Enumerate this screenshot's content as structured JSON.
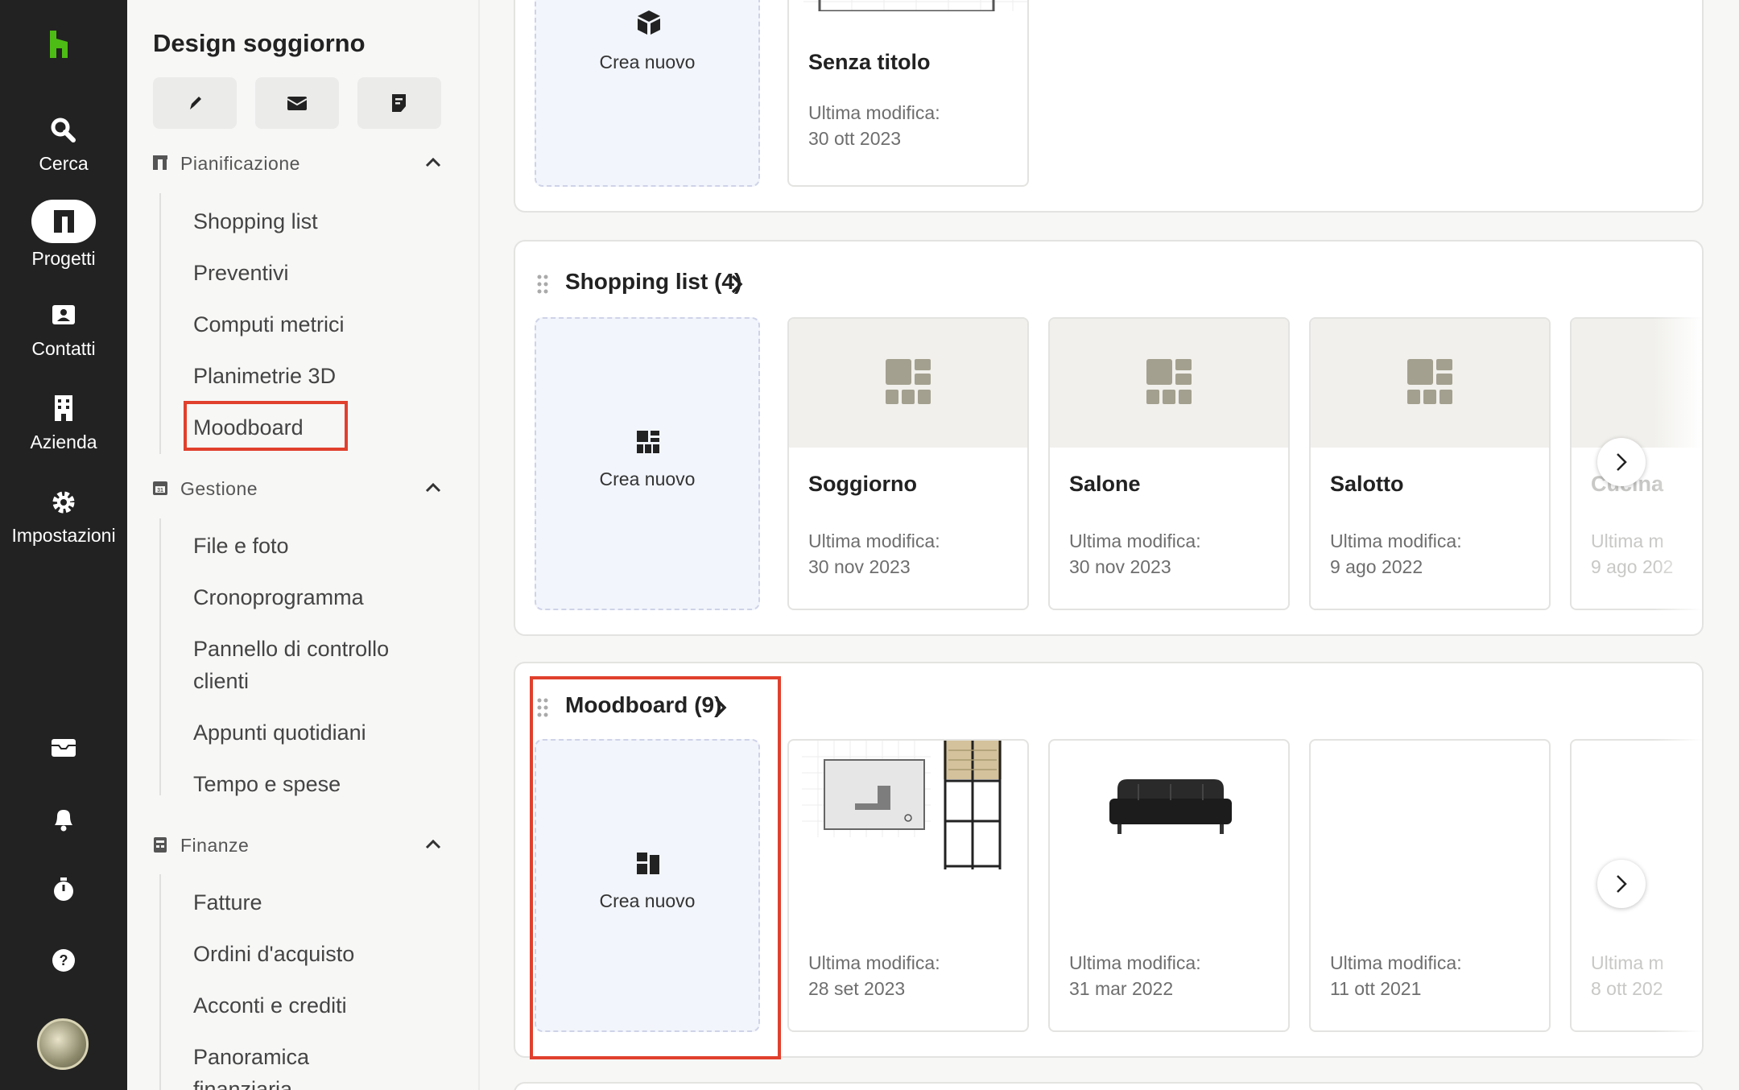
{
  "rail": {
    "logo_icon": "houzz-logo-icon",
    "brand_color": "#4dbc15",
    "items": [
      {
        "label": "Cerca",
        "icon": "search-icon"
      },
      {
        "label": "Progetti",
        "icon": "projects-icon"
      },
      {
        "label": "Contatti",
        "icon": "contacts-icon"
      },
      {
        "label": "Azienda",
        "icon": "building-icon"
      },
      {
        "label": "Impostazioni",
        "icon": "gear-icon"
      }
    ],
    "bottom_icons": [
      "inbox-icon",
      "bell-icon",
      "timer-icon",
      "help-icon",
      "avatar"
    ]
  },
  "sidebar": {
    "title": "Design soggiorno",
    "actions": [
      "edit-icon",
      "message-icon",
      "note-icon"
    ],
    "groups": [
      {
        "label": "Pianificazione",
        "items": [
          "Shopping list",
          "Preventivi",
          "Computi metrici",
          "Planimetrie 3D",
          "Moodboard"
        ]
      },
      {
        "label": "Gestione",
        "items": [
          "File e foto",
          "Cronoprogramma",
          "Pannello di controllo clienti",
          "Appunti quotidiani",
          "Tempo e spese"
        ]
      },
      {
        "label": "Finanze",
        "items": [
          "Fatture",
          "Ordini d'acquisto",
          "Acconti e crediti",
          "Panoramica finanziaria"
        ]
      }
    ]
  },
  "main": {
    "top_section": {
      "create_label": "Crea nuovo",
      "cards": [
        {
          "title": "Senza titolo",
          "meta_label": "Ultima modifica:",
          "date": "30 ott 2023"
        }
      ]
    },
    "shopping_section": {
      "title": "Shopping list (4)",
      "create_label": "Crea nuovo",
      "cards": [
        {
          "title": "Soggiorno",
          "meta_label": "Ultima modifica:",
          "date": "30 nov 2023"
        },
        {
          "title": "Salone",
          "meta_label": "Ultima modifica:",
          "date": "30 nov 2023"
        },
        {
          "title": "Salotto",
          "meta_label": "Ultima modifica:",
          "date": "9 ago 2022"
        },
        {
          "title": "Cucina",
          "meta_label": "Ultima m",
          "date": "9 ago 202"
        }
      ]
    },
    "moodboard_section": {
      "title": "Moodboard (9)",
      "create_label": "Crea nuovo",
      "cards": [
        {
          "meta_label": "Ultima modifica:",
          "date": "28 set 2023"
        },
        {
          "meta_label": "Ultima modifica:",
          "date": "31 mar 2022"
        },
        {
          "meta_label": "Ultima modifica:",
          "date": "11 ott 2021"
        },
        {
          "meta_label": "Ultima m",
          "date": "8 ott 202"
        }
      ]
    },
    "highlight_color": "#e0402d"
  }
}
